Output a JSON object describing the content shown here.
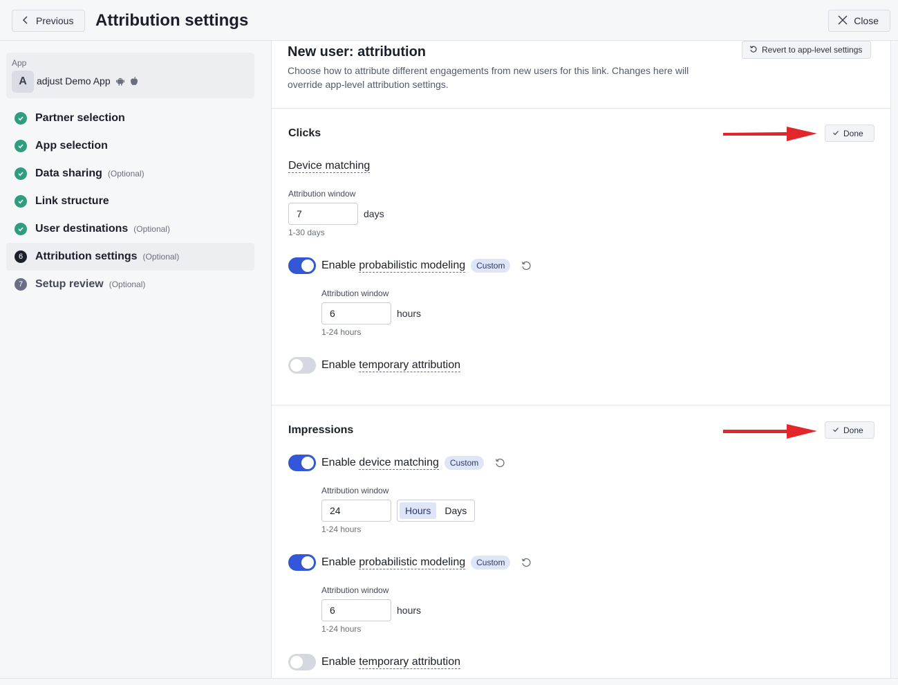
{
  "header": {
    "previous_label": "Previous",
    "title": "Attribution settings",
    "close_label": "Close"
  },
  "sidebar": {
    "app_label": "App",
    "app_avatar": "A",
    "app_name": "adjust Demo App",
    "platform_icons": [
      "android-icon",
      "apple-icon"
    ],
    "steps": [
      {
        "label": "Partner selection",
        "optional": "",
        "status": "done"
      },
      {
        "label": "App selection",
        "optional": "",
        "status": "done"
      },
      {
        "label": "Data sharing",
        "optional": "(Optional)",
        "status": "done"
      },
      {
        "label": "Link structure",
        "optional": "",
        "status": "done"
      },
      {
        "label": "User destinations",
        "optional": "(Optional)",
        "status": "done"
      },
      {
        "label": "Attribution settings",
        "optional": "(Optional)",
        "status": "active",
        "number": "6"
      },
      {
        "label": "Setup review",
        "optional": "(Optional)",
        "status": "todo",
        "number": "7"
      }
    ]
  },
  "main": {
    "section_title": "New user: attribution",
    "section_desc": "Choose how to attribute different engagements from new users for this link. Changes here will override app-level attribution settings.",
    "revert_label": "Revert to app-level settings",
    "clicks": {
      "title": "Clicks",
      "done_label": "Done",
      "device_matching_label": "Device matching",
      "attr_window_label": "Attribution window",
      "attr_window_value": "7",
      "attr_window_unit": "days",
      "attr_window_hint": "1-30 days",
      "prob_toggle_prefix": "Enable ",
      "prob_toggle_link": "probabilistic modeling",
      "prob_badge": "Custom",
      "prob_window_label": "Attribution window",
      "prob_window_value": "6",
      "prob_window_unit": "hours",
      "prob_window_hint": "1-24 hours",
      "temp_toggle_prefix": "Enable ",
      "temp_toggle_link": "temporary attribution"
    },
    "impressions": {
      "title": "Impressions",
      "done_label": "Done",
      "dm_toggle_prefix": "Enable ",
      "dm_toggle_link": "device matching",
      "dm_badge": "Custom",
      "dm_window_label": "Attribution window",
      "dm_window_value": "24",
      "dm_unit_hours": "Hours",
      "dm_unit_days": "Days",
      "dm_window_hint": "1-24 hours",
      "prob_toggle_prefix": "Enable ",
      "prob_toggle_link": "probabilistic modeling",
      "prob_badge": "Custom",
      "prob_window_label": "Attribution window",
      "prob_window_value": "6",
      "prob_window_unit": "hours",
      "prob_window_hint": "1-24 hours",
      "temp_toggle_prefix": "Enable ",
      "temp_toggle_link": "temporary attribution"
    }
  },
  "colors": {
    "accent": "#3457d5",
    "success": "#2f9d7f",
    "arrow": "#e3262c",
    "badge_bg": "#dde5f7"
  }
}
